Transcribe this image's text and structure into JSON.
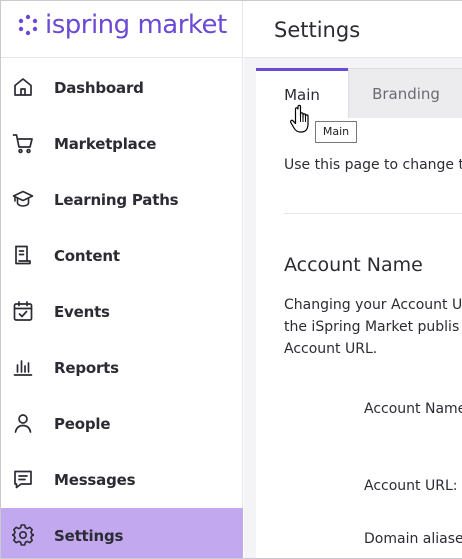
{
  "brand": {
    "logo_text_regular": "ispring",
    "logo_text_bold": "market",
    "accent_color": "#6b4ad6",
    "active_bg_color": "#c2a8ef"
  },
  "sidebar": {
    "items": [
      {
        "label": "Dashboard",
        "icon": "home-icon"
      },
      {
        "label": "Marketplace",
        "icon": "cart-icon"
      },
      {
        "label": "Learning Paths",
        "icon": "graduation-cap-icon"
      },
      {
        "label": "Content",
        "icon": "document-icon"
      },
      {
        "label": "Events",
        "icon": "calendar-check-icon"
      },
      {
        "label": "Reports",
        "icon": "bar-chart-icon"
      },
      {
        "label": "People",
        "icon": "person-icon"
      },
      {
        "label": "Messages",
        "icon": "message-icon"
      },
      {
        "label": "Settings",
        "icon": "gear-icon",
        "active": true
      }
    ]
  },
  "header": {
    "title": "Settings"
  },
  "tabs": [
    {
      "label": "Main",
      "active": true
    },
    {
      "label": "Branding",
      "active": false
    }
  ],
  "tooltip": {
    "text": "Main"
  },
  "main": {
    "intro": "Use this page to change t",
    "account_section": {
      "title": "Account Name",
      "description_lines": [
        "Changing your Account U",
        "the iSpring Market publis",
        "Account URL."
      ]
    },
    "fields": {
      "account_name_label": "Account Name",
      "account_url_label": "Account URL:",
      "domain_aliases_label": "Domain aliase"
    }
  }
}
